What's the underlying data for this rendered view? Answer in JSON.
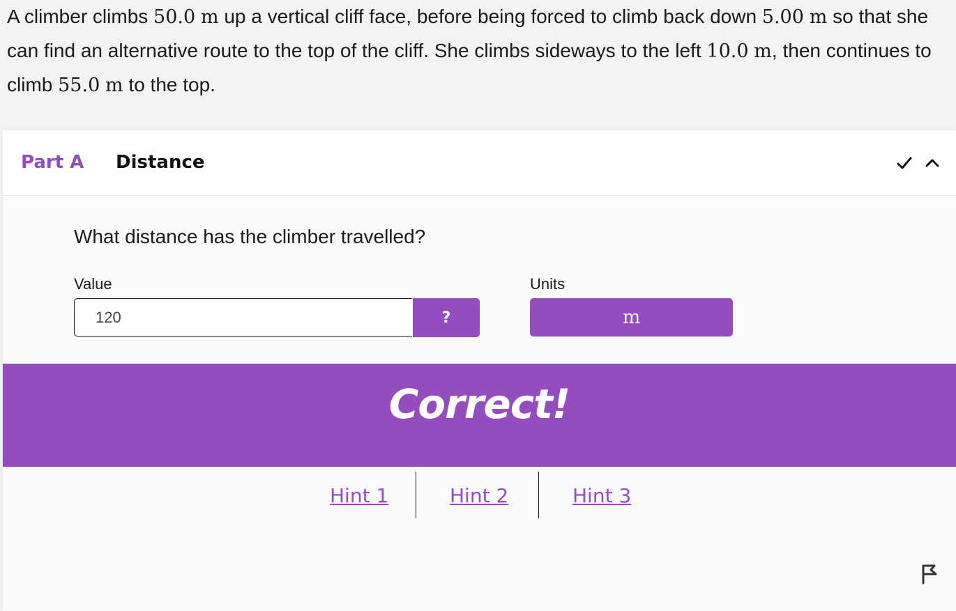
{
  "problem": {
    "text_1": "A climber climbs ",
    "val_1": "50.0",
    "unit_1": "m",
    "text_2": " up a vertical cliff face, before being forced to climb back down ",
    "val_2": "5.00",
    "unit_2": "m",
    "text_3": " so that she can find an alternative route to the top of the cliff. She climbs sideways to the left ",
    "val_3": "10.0",
    "unit_3": "m",
    "text_4": ", then continues to climb ",
    "val_4": "55.0",
    "unit_4": "m",
    "text_5": " to the top."
  },
  "part": {
    "label": "Part A",
    "title": "Distance",
    "status_icon": "check-icon",
    "toggle_icon": "chevron-up-icon",
    "question": "What distance has the climber travelled?",
    "value_label": "Value",
    "value": "120",
    "help_label": "?",
    "units_label": "Units",
    "units_value": "m"
  },
  "feedback": {
    "text": "Correct!"
  },
  "hints": [
    {
      "label": "Hint 1"
    },
    {
      "label": "Hint 2"
    },
    {
      "label": "Hint 3"
    }
  ],
  "colors": {
    "accent": "#944dbf",
    "background": "#f3f3f3",
    "card": "#fafafa"
  },
  "icons": {
    "report": "flag-icon"
  }
}
